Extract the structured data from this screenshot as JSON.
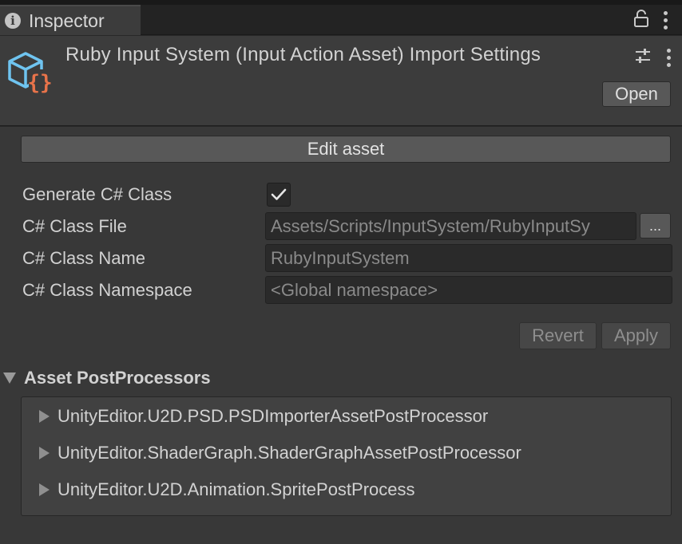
{
  "tab": {
    "icon": "info-icon",
    "icon_glyph": "i",
    "label": "Inspector"
  },
  "header": {
    "title": "Ruby Input System (Input Action Asset) Import Settings",
    "asset_icon": "input-action-asset-icon",
    "open_label": "Open"
  },
  "buttons": {
    "edit_asset": "Edit asset",
    "browse": "...",
    "revert": "Revert",
    "apply": "Apply"
  },
  "fields": {
    "generate_class": {
      "label": "Generate C# Class",
      "checked": true
    },
    "class_file": {
      "label": "C# Class File",
      "value": "Assets/Scripts/InputSystem/RubyInputSy"
    },
    "class_name": {
      "label": "C# Class Name",
      "value": "RubyInputSystem"
    },
    "class_namespace": {
      "label": "C# Class Namespace",
      "placeholder": "<Global namespace>"
    }
  },
  "postprocessors": {
    "title": "Asset PostProcessors",
    "expanded": true,
    "items": [
      {
        "label": "UnityEditor.U2D.PSD.PSDImporterAssetPostProcessor"
      },
      {
        "label": "UnityEditor.ShaderGraph.ShaderGraphAssetPostProcessor"
      },
      {
        "label": "UnityEditor.U2D.Animation.SpritePostProcess"
      }
    ]
  },
  "colors": {
    "icon_blue": "#6fc4f0",
    "icon_orange": "#e8734a"
  }
}
